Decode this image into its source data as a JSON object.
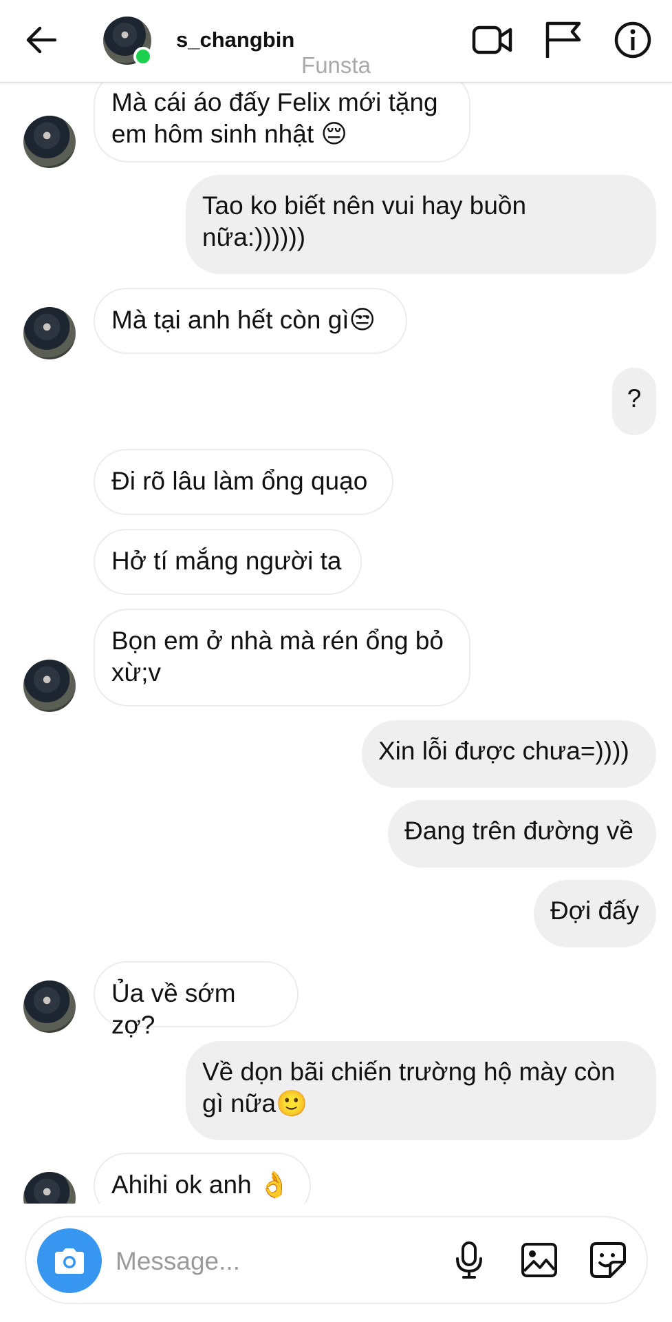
{
  "header": {
    "username": "s_changbin",
    "watermark": "Funsta"
  },
  "messages": [
    {
      "side": "in",
      "text": "Mà cái áo đấy Felix mới tặng\nem hôm sinh nhật 😔",
      "avatar": true
    },
    {
      "side": "out",
      "text": "Tao ko biết nên vui hay buồn\nnữa:))))))"
    },
    {
      "side": "in",
      "text": "Mà tại anh hết còn gì😒",
      "avatar": true
    },
    {
      "side": "out",
      "text": "?"
    },
    {
      "side": "in",
      "text": "Đi rõ lâu làm ổng quạo"
    },
    {
      "side": "in",
      "text": "Hở tí mắng người ta"
    },
    {
      "side": "in",
      "text": "Bọn em ở nhà mà rén ổng bỏ\nxừ;v",
      "avatar": true
    },
    {
      "side": "out",
      "text": "Xin lỗi được chưa=))))"
    },
    {
      "side": "out",
      "text": "Đang trên đường về"
    },
    {
      "side": "out",
      "text": "Đợi đấy"
    },
    {
      "side": "in",
      "text": "Ủa về sớm zợ?",
      "avatar": true
    },
    {
      "side": "out",
      "text": "Về dọn bãi chiến trường hộ mày còn\ngì nữa🙂"
    },
    {
      "side": "in",
      "text": "Ahihi ok anh 👌",
      "avatar": true
    }
  ],
  "composer": {
    "placeholder": "Message..."
  }
}
